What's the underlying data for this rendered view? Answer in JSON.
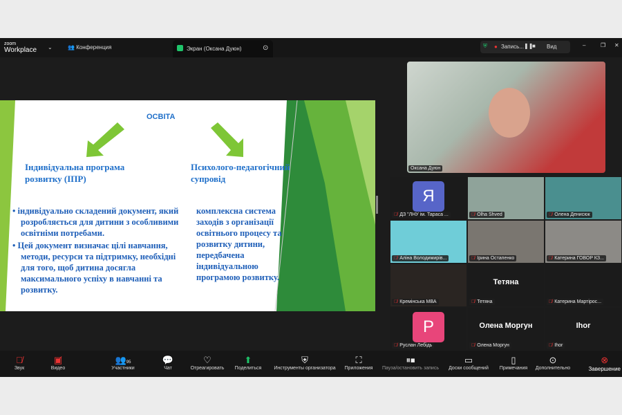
{
  "topbar": {
    "logo_small": "zoom",
    "logo_big": "Workplace",
    "conference": "Конференция",
    "screen_tab": "Экран (Оксана Дуюн)",
    "recording": "Запись...",
    "view": "Вид"
  },
  "slide": {
    "title": "ОСВІТА",
    "left_heading": "Індивідуальна програма розвитку (ІПР)",
    "right_heading": "Психолого-педагогічний супровід",
    "left_bullets": [
      "індивідуально складений документ, який розробляється для дитини з особливими освітніми потребами.",
      "Цей документ визначає цілі навчання, методи, ресурси та підтримку, необхідні для того, щоб дитина досягла максимального успіху в навчанні та розвитку."
    ],
    "right_text": "комплексна система заходів з організації освітнього процесу та розвитку дитини, передбачена індивідуальною програмою розвитку."
  },
  "speaker": {
    "name": "Оксана Дуюн"
  },
  "tiles": [
    {
      "name": "ДЗ \"ЛНУ ім. Тараса ...",
      "avatar": "Я",
      "color": "#5765c8"
    },
    {
      "name": "Olha Shved"
    },
    {
      "name": "Олена Денисюк"
    },
    {
      "name": "Аліна Володимирів..."
    },
    {
      "name": "Ірина Остапенко"
    },
    {
      "name": "Катерина ГОВОР КЗ..."
    },
    {
      "name": "Кремінська МВА"
    },
    {
      "name": "Тетяна",
      "big": "Тетяна"
    },
    {
      "name": "Катерина Мартірос..."
    },
    {
      "name": "Руслан Лебідь",
      "avatar": "Р",
      "color": "#e8457a"
    },
    {
      "name": "Олена Моргун",
      "big": "Олена Моргун"
    },
    {
      "name": "Ihor",
      "big": "Ihor"
    }
  ],
  "toolbar": {
    "audio": "Звук",
    "video": "Видео",
    "participants": "Участники",
    "participants_count": "95",
    "chat": "Чат",
    "react": "Отреагировать",
    "share": "Поделиться",
    "host_tools": "Инструменты организатора",
    "apps": "Приложения",
    "pause_rec": "Пауза/остановить запись",
    "whiteboards": "Доски сообщений",
    "notes": "Примечания",
    "more": "Дополнительно",
    "end": "Завершение"
  }
}
